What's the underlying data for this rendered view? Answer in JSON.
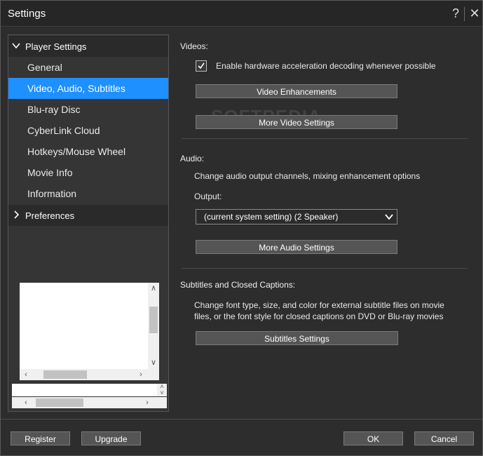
{
  "window": {
    "title": "Settings",
    "help_glyph": "?",
    "close_glyph": "✕"
  },
  "sidebar": {
    "group1": {
      "label": "Player Settings"
    },
    "items": [
      {
        "label": "General"
      },
      {
        "label": "Video, Audio, Subtitles",
        "selected": true
      },
      {
        "label": "Blu-ray Disc"
      },
      {
        "label": "CyberLink Cloud"
      },
      {
        "label": "Hotkeys/Mouse Wheel"
      },
      {
        "label": "Movie Info"
      },
      {
        "label": "Information"
      }
    ],
    "group2": {
      "label": "Preferences"
    }
  },
  "videos": {
    "heading": "Videos:",
    "hw_accel_label": "Enable hardware acceleration decoding whenever possible",
    "hw_accel_checked": true,
    "enhancements_button": "Video Enhancements",
    "more_button": "More Video Settings"
  },
  "audio": {
    "heading": "Audio:",
    "description": "Change audio output channels, mixing enhancement options",
    "output_label": "Output:",
    "output_value": "(current system setting) (2 Speaker)",
    "more_button": "More Audio Settings"
  },
  "subtitles": {
    "heading": "Subtitles and Closed Captions:",
    "description_line1": "Change font type, size, and color for external subtitle files on movie",
    "description_line2": "files, or the font style for closed captions on DVD or Blu-ray movies",
    "button": "Subtitles Settings"
  },
  "footer": {
    "register_button": "Register",
    "upgrade_button": "Upgrade",
    "ok_button": "OK",
    "cancel_button": "Cancel"
  },
  "watermark": "SOFTPEDIA",
  "colors": {
    "accent": "#1e90ff",
    "background": "#2d2d2d"
  }
}
